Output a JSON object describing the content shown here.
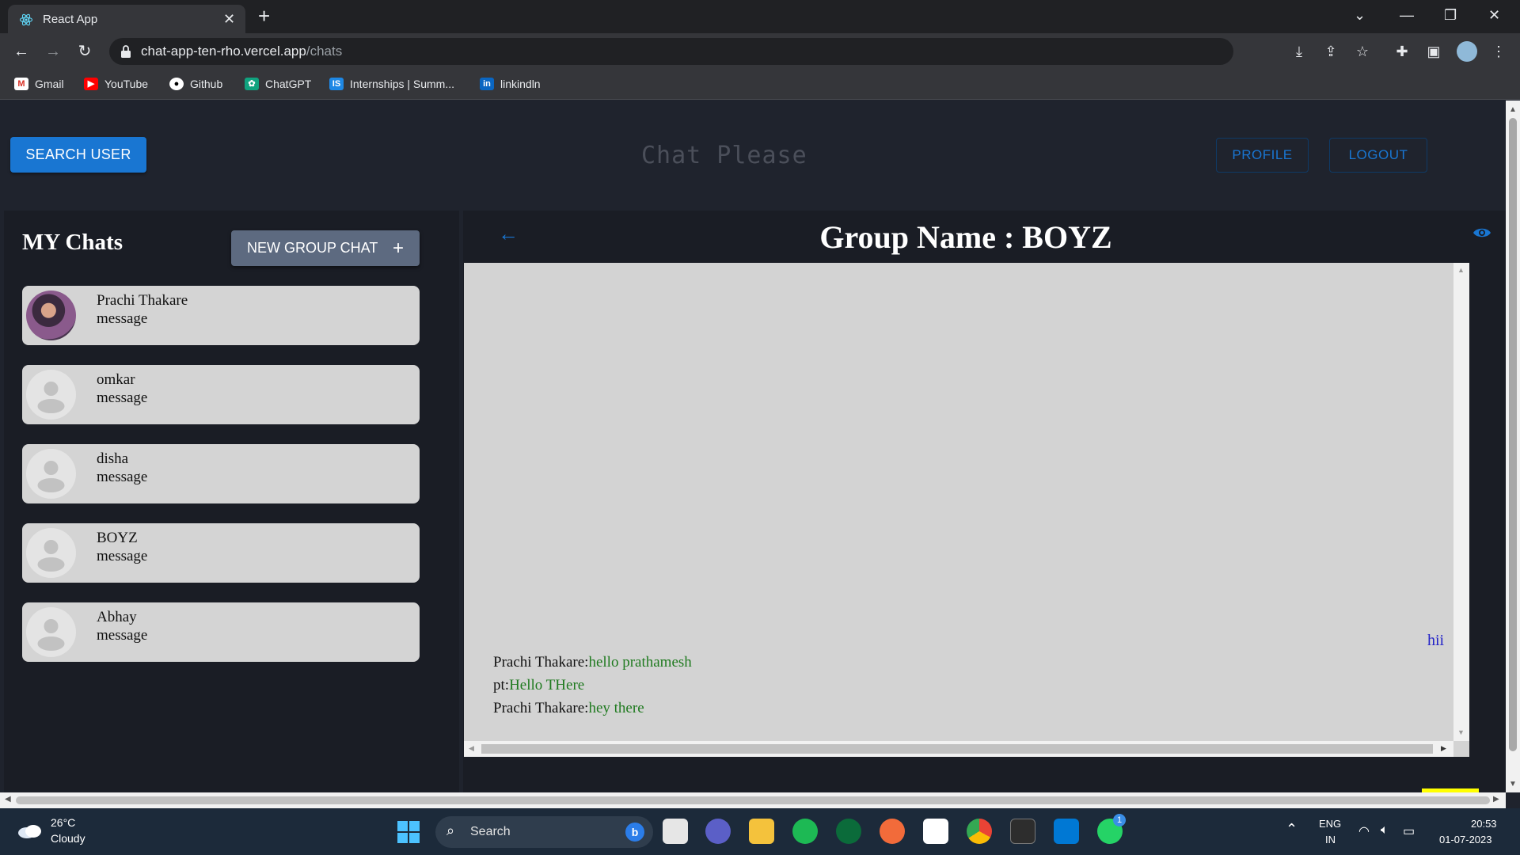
{
  "browser": {
    "tab_title": "React App",
    "url_host": "chat-app-ten-rho.vercel.app",
    "url_path": "/chats",
    "bookmarks": [
      {
        "label": "Gmail"
      },
      {
        "label": "YouTube"
      },
      {
        "label": "Github"
      },
      {
        "label": "ChatGPT"
      },
      {
        "label": "Internships | Summ..."
      },
      {
        "label": "linkindln"
      }
    ]
  },
  "header": {
    "search_user_label": "SEARCH USER",
    "app_title": "Chat Please",
    "profile_label": "PROFILE",
    "logout_label": "LOGOUT"
  },
  "sidebar": {
    "title": "MY Chats",
    "new_group_label": "NEW GROUP CHAT",
    "chats": [
      {
        "name": "Prachi Thakare",
        "preview": "message"
      },
      {
        "name": "omkar",
        "preview": "message"
      },
      {
        "name": "disha",
        "preview": "message"
      },
      {
        "name": "BOYZ",
        "preview": "message"
      },
      {
        "name": "Abhay",
        "preview": "message"
      }
    ]
  },
  "chat": {
    "title": "Group Name : BOYZ",
    "my_message": "hii",
    "messages": [
      {
        "sender": "Prachi Thakare:",
        "text": "hello prathamesh"
      },
      {
        "sender": "pt:",
        "text": "Hello THere"
      },
      {
        "sender": "Prachi Thakare:",
        "text": "hey there"
      }
    ]
  },
  "taskbar": {
    "temperature": "26°C",
    "weather": "Cloudy",
    "search_label": "Search",
    "lang": "ENG",
    "region": "IN",
    "time": "20:53",
    "date": "01-07-2023",
    "whatsapp_badge": "1"
  },
  "colors": {
    "primary": "#1976d2",
    "app_bg": "#1f232d",
    "card_bg": "#d4d4d4",
    "message_text": "#1f7a1f",
    "my_message": "#2222c8",
    "input_bg": "#add8e6",
    "send_button": "#ffff00"
  }
}
